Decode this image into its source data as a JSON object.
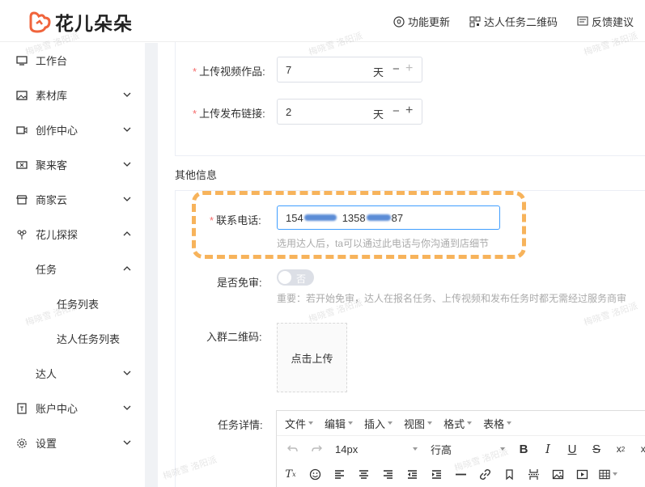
{
  "app": {
    "name": "花儿朵朵",
    "brand_color": "#f0643c"
  },
  "header": {
    "links": [
      {
        "icon": "lightbulb-icon",
        "label": "功能更新"
      },
      {
        "icon": "qrcode-icon",
        "label": "达人任务二维码"
      },
      {
        "icon": "feedback-icon",
        "label": "反馈建议"
      }
    ]
  },
  "sidebar": {
    "items": [
      {
        "icon": "monitor-icon",
        "label": "工作台"
      },
      {
        "icon": "image-icon",
        "label": "素材库"
      },
      {
        "icon": "video-icon",
        "label": "创作中心"
      },
      {
        "icon": "ticket-icon",
        "label": "聚来客"
      },
      {
        "icon": "shop-icon",
        "label": "商家云"
      },
      {
        "icon": "flower-icon",
        "label": "花儿探探"
      },
      {
        "label": "任务"
      },
      {
        "label": "任务列表"
      },
      {
        "label": "达人任务列表"
      },
      {
        "label": "达人"
      },
      {
        "icon": "wallet-icon",
        "label": "账户中心"
      },
      {
        "icon": "gear-icon",
        "label": "设置"
      }
    ]
  },
  "form_top": {
    "upload_video": {
      "label": "上传视频作品:",
      "value": "7",
      "unit": "天"
    },
    "publish_link": {
      "label": "上传发布链接:",
      "value": "2",
      "unit": "天"
    }
  },
  "section": {
    "title": "其他信息"
  },
  "form_bottom": {
    "phone": {
      "label": "联系电话:",
      "value_start": "154",
      "value_mid": "1358",
      "value_end": "87",
      "hint": "选用达人后，ta可以通过此电话与你沟通到店细节"
    },
    "free_review": {
      "label": "是否免审:",
      "switch_text": "否",
      "hint": "重要：若开始免审，达人在报名任务、上传视频和发布任务时都无需经过服务商审"
    },
    "group_qr": {
      "label": "入群二维码:",
      "upload_text": "点击上传"
    },
    "details": {
      "label": "任务详情:"
    }
  },
  "editor": {
    "menus": [
      "文件",
      "编辑",
      "插入",
      "视图",
      "格式",
      "表格"
    ],
    "font_size": "14px",
    "line_height": "行高"
  },
  "watermark": "梅晓雪 洛阳派"
}
